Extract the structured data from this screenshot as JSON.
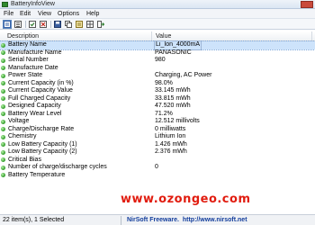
{
  "window": {
    "title": "BatteryInfoView"
  },
  "menu": {
    "items": [
      "File",
      "Edit",
      "View",
      "Options",
      "Help"
    ]
  },
  "toolbar": {
    "buttons": [
      "view-mode-icon",
      "list-icon",
      "check-icon",
      "close-icon",
      "save-icon",
      "copy-icon",
      "properties-icon",
      "grid-icon",
      "exit-icon"
    ]
  },
  "table": {
    "columns": [
      "Description",
      "Value"
    ],
    "rows": [
      {
        "name": "Battery Name",
        "value": "Li_Ion_4000mA",
        "selected": true
      },
      {
        "name": "Manufacture Name",
        "value": "PANASONIC"
      },
      {
        "name": "Serial Number",
        "value": "980"
      },
      {
        "name": "Manufacture Date",
        "value": ""
      },
      {
        "name": "Power State",
        "value": "Charging, AC Power"
      },
      {
        "name": "Current Capacity (in %)",
        "value": "98.0%"
      },
      {
        "name": "Current Capacity Value",
        "value": "33.145 mWh"
      },
      {
        "name": "Full Charged Capacity",
        "value": "33.815 mWh"
      },
      {
        "name": "Designed Capacity",
        "value": "47.520 mWh"
      },
      {
        "name": "Battery Wear Level",
        "value": "71.2%"
      },
      {
        "name": "Voltage",
        "value": "12.512 millivolts"
      },
      {
        "name": "Charge/Discharge Rate",
        "value": "0 milliwatts"
      },
      {
        "name": "Chemistry",
        "value": "Lithium Ion"
      },
      {
        "name": "Low Battery Capacity (1)",
        "value": "1.426 mWh"
      },
      {
        "name": "Low Battery Capacity (2)",
        "value": "2.376 mWh"
      },
      {
        "name": "Critical Bias",
        "value": ""
      },
      {
        "name": "Number of charge/discharge cycles",
        "value": "0"
      },
      {
        "name": "Battery Temperature",
        "value": ""
      }
    ]
  },
  "watermark": "www.ozongeo.com",
  "status": {
    "items": "22 item(s), 1 Selected",
    "credit": "NirSoft Freeware.",
    "url": "http://www.nirsoft.net"
  }
}
